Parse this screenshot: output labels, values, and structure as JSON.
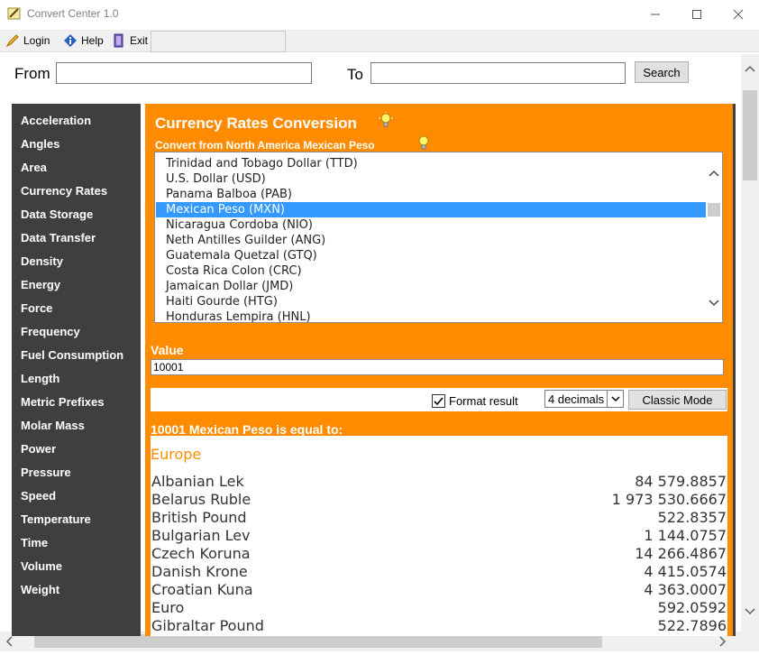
{
  "window": {
    "title": "Convert Center 1.0",
    "controls": [
      "minimize",
      "maximize",
      "close"
    ]
  },
  "menu": {
    "items": [
      {
        "label": "Login",
        "icon": "pencil-icon"
      },
      {
        "label": "Help",
        "icon": "info-icon"
      },
      {
        "label": "Exit",
        "icon": "exit-icon"
      }
    ]
  },
  "search": {
    "from_label": "From",
    "from_value": "",
    "to_label": "To",
    "to_value": "",
    "button_label": "Search"
  },
  "sidebar": {
    "items": [
      "Acceleration",
      "Angles",
      "Area",
      "Currency Rates",
      "Data Storage",
      "Data Transfer",
      "Density",
      "Energy",
      "Force",
      "Frequency",
      "Fuel Consumption",
      "Length",
      "Metric Prefixes",
      "Molar Mass",
      "Power",
      "Pressure",
      "Speed",
      "Temperature",
      "Time",
      "Volume",
      "Weight"
    ]
  },
  "main": {
    "title": "Currency Rates Conversion",
    "subtitle": "Convert from North America Mexican Peso",
    "currency_list": [
      "Trinidad and Tobago Dollar (TTD)",
      "U.S. Dollar (USD)",
      "Panama Balboa (PAB)",
      "Mexican Peso (MXN)",
      "Nicaragua Cordoba (NIO)",
      "Neth Antilles Guilder (ANG)",
      "Guatemala Quetzal (GTQ)",
      "Costa Rica Colon (CRC)",
      "Jamaican Dollar (JMD)",
      "Haiti Gourde (HTG)",
      "Honduras Lempira (HNL)"
    ],
    "selected_index": 3,
    "value_label": "Value",
    "value": "10001",
    "format_result_label": "Format result",
    "format_result_checked": true,
    "decimals_selected": "4 decimals",
    "classic_mode_label": "Classic Mode",
    "result_heading": "10001 Mexican Peso is equal to:",
    "region": "Europe",
    "results": [
      {
        "name": "Albanian Lek",
        "value": "84 579.8857"
      },
      {
        "name": "Belarus Ruble",
        "value": "1 973 530.6667"
      },
      {
        "name": "British Pound",
        "value": "522.8357"
      },
      {
        "name": "Bulgarian Lev",
        "value": "1 144.0757"
      },
      {
        "name": "Czech Koruna",
        "value": "14 266.4867"
      },
      {
        "name": "Danish Krone",
        "value": "4 415.0574"
      },
      {
        "name": "Croatian Kuna",
        "value": "4 363.0007"
      },
      {
        "name": "Euro",
        "value": "592.0592"
      },
      {
        "name": "Gibraltar Pound",
        "value": "522.7896"
      }
    ]
  },
  "colors": {
    "panel": "#ff8c00",
    "sidebar": "#3f3f3f",
    "selection": "#3399ff",
    "region_text": "#ff8c00"
  }
}
